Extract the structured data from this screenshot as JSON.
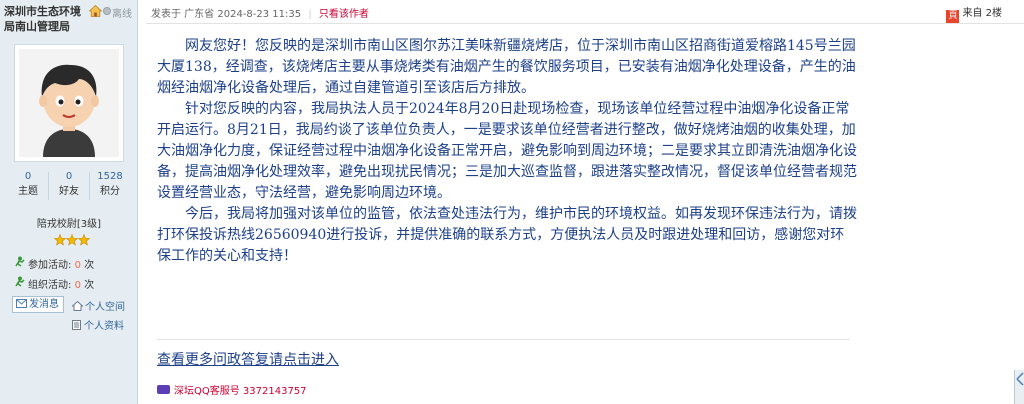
{
  "author": {
    "name": "深圳市生态环境局南山管理局",
    "status": "离线",
    "stats": [
      {
        "value": "0",
        "label": "主题"
      },
      {
        "value": "0",
        "label": "好友"
      },
      {
        "value": "1528",
        "label": "积分"
      }
    ],
    "rank": "陪戎校尉[3级]",
    "rank_stars": 3,
    "activities": [
      {
        "label": "参加活动:",
        "count": "0",
        "unit": "次"
      },
      {
        "label": "组织活动:",
        "count": "0",
        "unit": "次"
      }
    ],
    "send_message": "发消息",
    "personal_space": "个人空间",
    "personal_profile": "个人资料"
  },
  "post": {
    "posted_in": "发表于 广东省",
    "datetime": "2024-8-23 11:35",
    "only_author": "只看该作者",
    "source_badge": "頁",
    "source_text": "来自 2楼",
    "paragraphs": [
      "网友您好！您反映的是深圳市南山区图尔苏江美味新疆烧烤店，位于深圳市南山区招商街道爱榕路145号兰园大厦138，经调查，该烧烤店主要从事烧烤类有油烟产生的餐饮服务项目，已安装有油烟净化处理设备，产生的油烟经油烟净化设备处理后，通过自建管道引至该店后方排放。",
      "针对您反映的内容，我局执法人员于2024年8月20日赴现场检查，现场该单位经营过程中油烟净化设备正常开启运行。8月21日，我局约谈了该单位负责人，一是要求该单位经营者进行整改，做好烧烤油烟的收集处理，加大油烟净化力度，保证经营过程中油烟净化设备正常开启，避免影响到周边环境；二是要求其立即清洗油烟净化设备，提高油烟净化处理效率，避免出现扰民情况；三是加大巡查监督，跟进落实整改情况，督促该单位经营者规范设置经营业态，守法经营，避免影响周边环境。",
      "今后，我局将加强对该单位的监管，依法查处违法行为，维护市民的环境权益。如再发现环保违法行为，请拨打环保投诉热线26560940进行投诉，并提供准确的联系方式，方便执法人员及时跟进处理和回访，感谢您对环保工作的关心和支持！"
    ],
    "more_link": "查看更多问政答复请点击进入",
    "qq_service": "深坛QQ客服号 3372143757"
  },
  "colors": {
    "sidebar_bg": "#e5edf2",
    "body_text": "#1d4089",
    "accent_red": "#cc0033",
    "link_blue": "#336699"
  },
  "icons": [
    "home-icon",
    "offline-status-icon",
    "avatar-image",
    "star-icon",
    "activity-icon",
    "envelope-icon",
    "personal-space-icon",
    "profile-icon",
    "source-badge-icon",
    "qq-icon"
  ]
}
